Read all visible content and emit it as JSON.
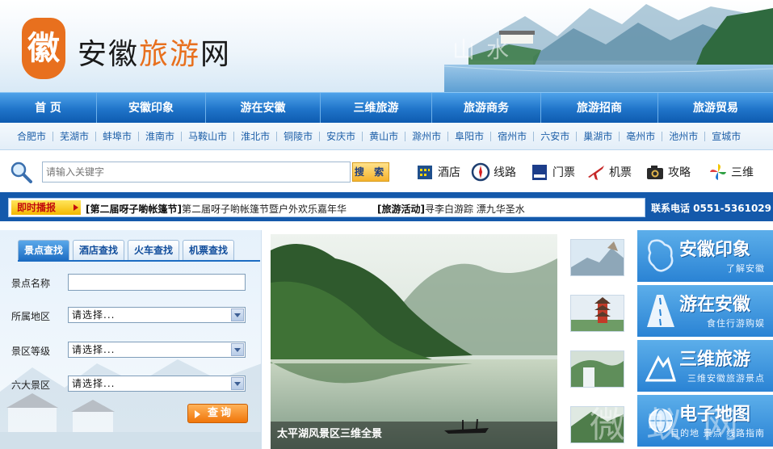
{
  "header": {
    "logo_seal": "徽",
    "logo_part1": "安徽",
    "logo_part2": "旅游",
    "logo_part3": "网",
    "watermark": "山水"
  },
  "main_nav": [
    {
      "label": "首  页"
    },
    {
      "label": "安徽印象"
    },
    {
      "label": "游在安徽"
    },
    {
      "label": "三维旅游"
    },
    {
      "label": "旅游商务"
    },
    {
      "label": "旅游招商"
    },
    {
      "label": "旅游贸易"
    }
  ],
  "cities": [
    "合肥市",
    "芜湖市",
    "蚌埠市",
    "淮南市",
    "马鞍山市",
    "淮北市",
    "铜陵市",
    "安庆市",
    "黄山市",
    "滁州市",
    "阜阳市",
    "宿州市",
    "六安市",
    "巢湖市",
    "亳州市",
    "池州市",
    "宣城市"
  ],
  "search": {
    "placeholder": "请输入关键字",
    "button": "搜 索",
    "quick_links": [
      {
        "label": "酒店",
        "icon": "hotel-icon"
      },
      {
        "label": "线路",
        "icon": "compass-icon"
      },
      {
        "label": "门票",
        "icon": "ticket-icon"
      },
      {
        "label": "机票",
        "icon": "airplane-icon"
      },
      {
        "label": "攻略",
        "icon": "camera-icon"
      },
      {
        "label": "三维",
        "icon": "pinwheel-icon"
      }
    ]
  },
  "ticker": {
    "label": "即时播报",
    "item1_tag": "[第二届呀子喲帐篷节]",
    "item1_text": "第二届呀子喲帐篷节暨户外欢乐嘉年华",
    "item2_tag": "[旅游活动]",
    "item2_text": "寻李白游踪 漂九华圣水",
    "phone": "联系电话  0551-5361029"
  },
  "search_panel": {
    "tabs": [
      "景点查找",
      "酒店查找",
      "火车查找",
      "机票查找"
    ],
    "fields": {
      "name_label": "景点名称",
      "region_label": "所属地区",
      "region_value": "请选择...",
      "level_label": "景区等级",
      "level_value": "请选择...",
      "area_label": "六大景区",
      "area_value": "请选择..."
    },
    "query_button": "查询"
  },
  "feature": {
    "caption": "太平湖风景区三维全景"
  },
  "banners": [
    {
      "title": "安徽印象",
      "subtitle": "了解安徽"
    },
    {
      "title": "游在安徽",
      "subtitle": "食住行游购娱"
    },
    {
      "title": "三维旅游",
      "subtitle": "三维安徽旅游景点"
    },
    {
      "title": "电子地图",
      "subtitle": "目的地 景点 线路指南"
    }
  ],
  "watermark_bottom": "微 蚁 网"
}
